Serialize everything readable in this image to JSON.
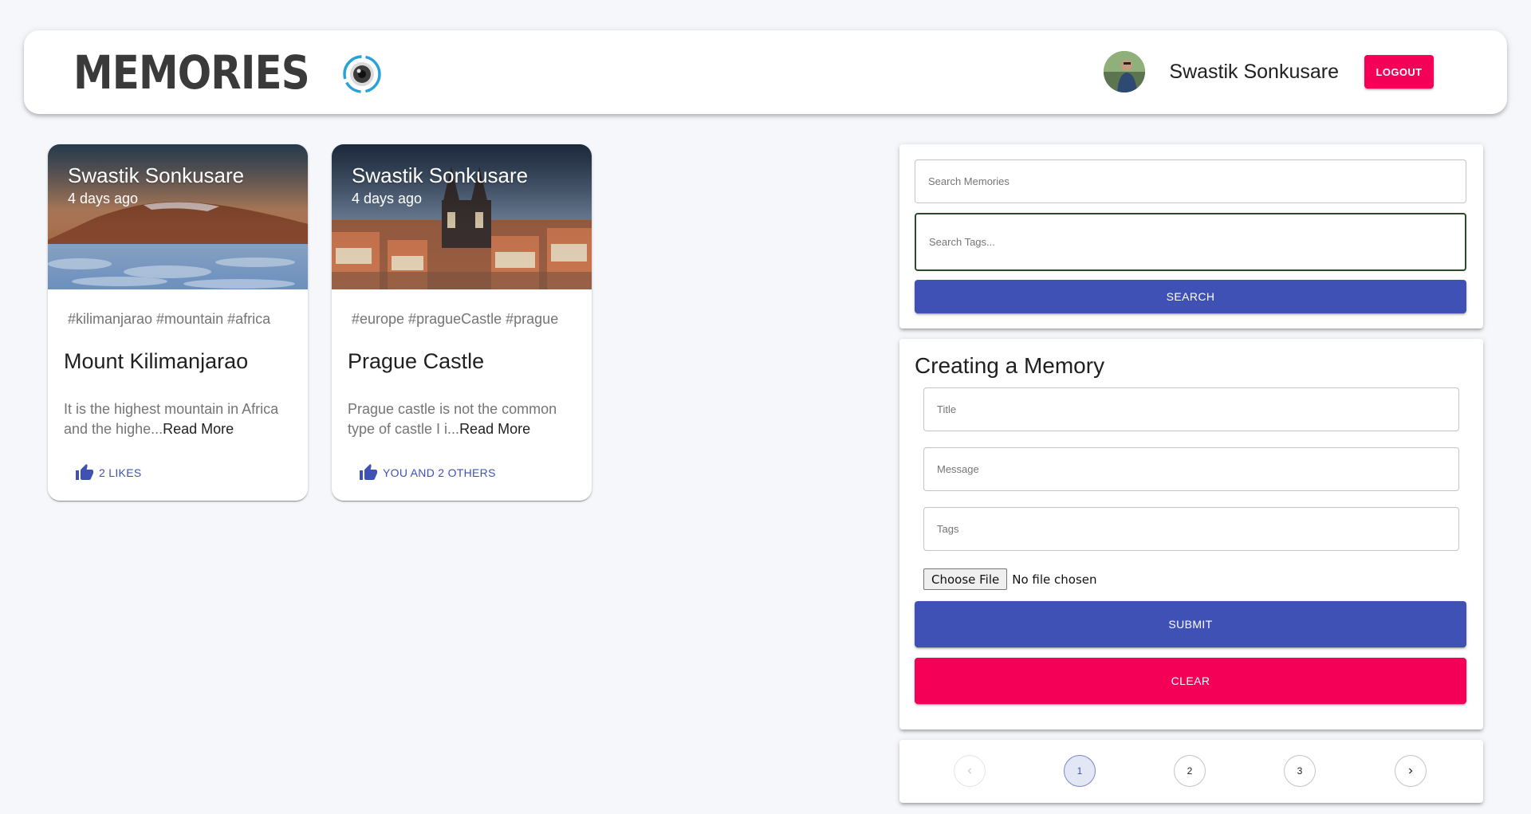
{
  "header": {
    "brand_text": "Memories",
    "brand_icon": "camera-lens-icon",
    "user_name": "Swastik Sonkusare",
    "logout_label": "LOGOUT",
    "accent_color": "#f50057"
  },
  "posts": [
    {
      "author": "Swastik Sonkusare",
      "time": "4 days ago",
      "tags": "#kilimanjarao #mountain #africa",
      "title": "Mount Kilimanjarao",
      "message_preview": "It is the highest mountain in Africa and the highe...",
      "read_more": "Read More",
      "likes_label": "2 LIKES"
    },
    {
      "author": "Swastik Sonkusare",
      "time": "4 days ago",
      "tags": "#europe #pragueCastle #prague",
      "title": "Prague Castle",
      "message_preview": "Prague castle is not the common type of castle I i...",
      "read_more": "Read More",
      "likes_label": "YOU AND 2 OTHERS"
    }
  ],
  "search": {
    "memories_placeholder": "Search Memories",
    "tags_placeholder": "Search Tags...",
    "button_label": "SEARCH",
    "primary_color": "#3f51b5"
  },
  "form": {
    "heading": "Creating a Memory",
    "title_placeholder": "Title",
    "message_placeholder": "Message",
    "tags_placeholder": "Tags",
    "file_button_label": "Choose File",
    "file_status": "No file chosen",
    "submit_label": "SUBMIT",
    "clear_label": "CLEAR"
  },
  "pagination": {
    "pages": [
      "1",
      "2",
      "3"
    ],
    "current_page": "1"
  }
}
